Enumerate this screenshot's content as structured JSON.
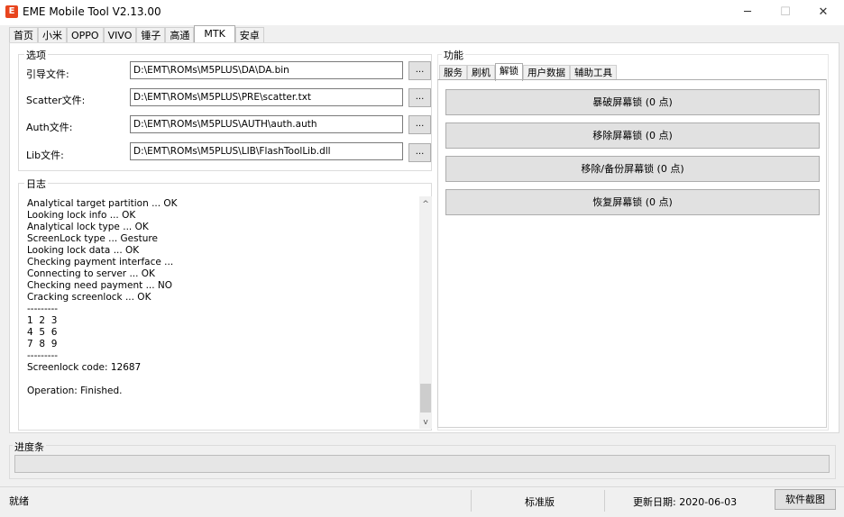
{
  "window": {
    "title": "EME Mobile Tool V2.13.00",
    "icon": "app-logo-icon",
    "minimize": "─",
    "maximize": "☐",
    "close": "✕"
  },
  "main_tabs": [
    {
      "label": "首页"
    },
    {
      "label": "小米"
    },
    {
      "label": "OPPO"
    },
    {
      "label": "VIVO"
    },
    {
      "label": "锤子"
    },
    {
      "label": "高通"
    },
    {
      "label": "MTK"
    },
    {
      "label": "安卓"
    }
  ],
  "active_main_tab": "MTK",
  "options": {
    "title": "选项",
    "browse_label": "...",
    "rows": [
      {
        "label": "引导文件:",
        "value": "D:\\EMT\\ROMs\\M5PLUS\\DA\\DA.bin"
      },
      {
        "label": "Scatter文件:",
        "value": "D:\\EMT\\ROMs\\M5PLUS\\PRE\\scatter.txt"
      },
      {
        "label": "Auth文件:",
        "value": "D:\\EMT\\ROMs\\M5PLUS\\AUTH\\auth.auth"
      },
      {
        "label": "Lib文件:",
        "value": "D:\\EMT\\ROMs\\M5PLUS\\LIB\\FlashToolLib.dll"
      }
    ]
  },
  "log": {
    "title": "日志",
    "lines": [
      "Analytical target partition ... OK",
      "Looking lock info ... OK",
      "Analytical lock type ... OK",
      "ScreenLock type ... Gesture",
      "Looking lock data ... OK",
      "Checking payment interface ...",
      "Connecting to server ... OK",
      "Checking need payment ... NO",
      "Cracking screenlock ... OK",
      "---------",
      "1  2  3",
      "4  5  6",
      "7  8  9",
      "---------",
      "Screenlock code: 12687",
      "",
      "Operation: Finished."
    ],
    "scroll_up": "^",
    "scroll_down": "v"
  },
  "functions": {
    "title": "功能",
    "tabs": [
      {
        "label": "服务"
      },
      {
        "label": "刷机"
      },
      {
        "label": "解锁"
      },
      {
        "label": "用户数据"
      },
      {
        "label": "辅助工具"
      }
    ],
    "active_tab": "解锁",
    "buttons": [
      {
        "label": "暴破屏幕锁 (0 点)"
      },
      {
        "label": "移除屏幕锁 (0 点)"
      },
      {
        "label": "移除/备份屏幕锁 (0 点)"
      },
      {
        "label": "恢复屏幕锁 (0 点)"
      }
    ]
  },
  "progress": {
    "title": "进度条",
    "value": 0
  },
  "status": {
    "ready": "就绪",
    "edition": "标准版",
    "update_date": "更新日期: 2020-06-03",
    "screenshot_button": "软件截图"
  }
}
